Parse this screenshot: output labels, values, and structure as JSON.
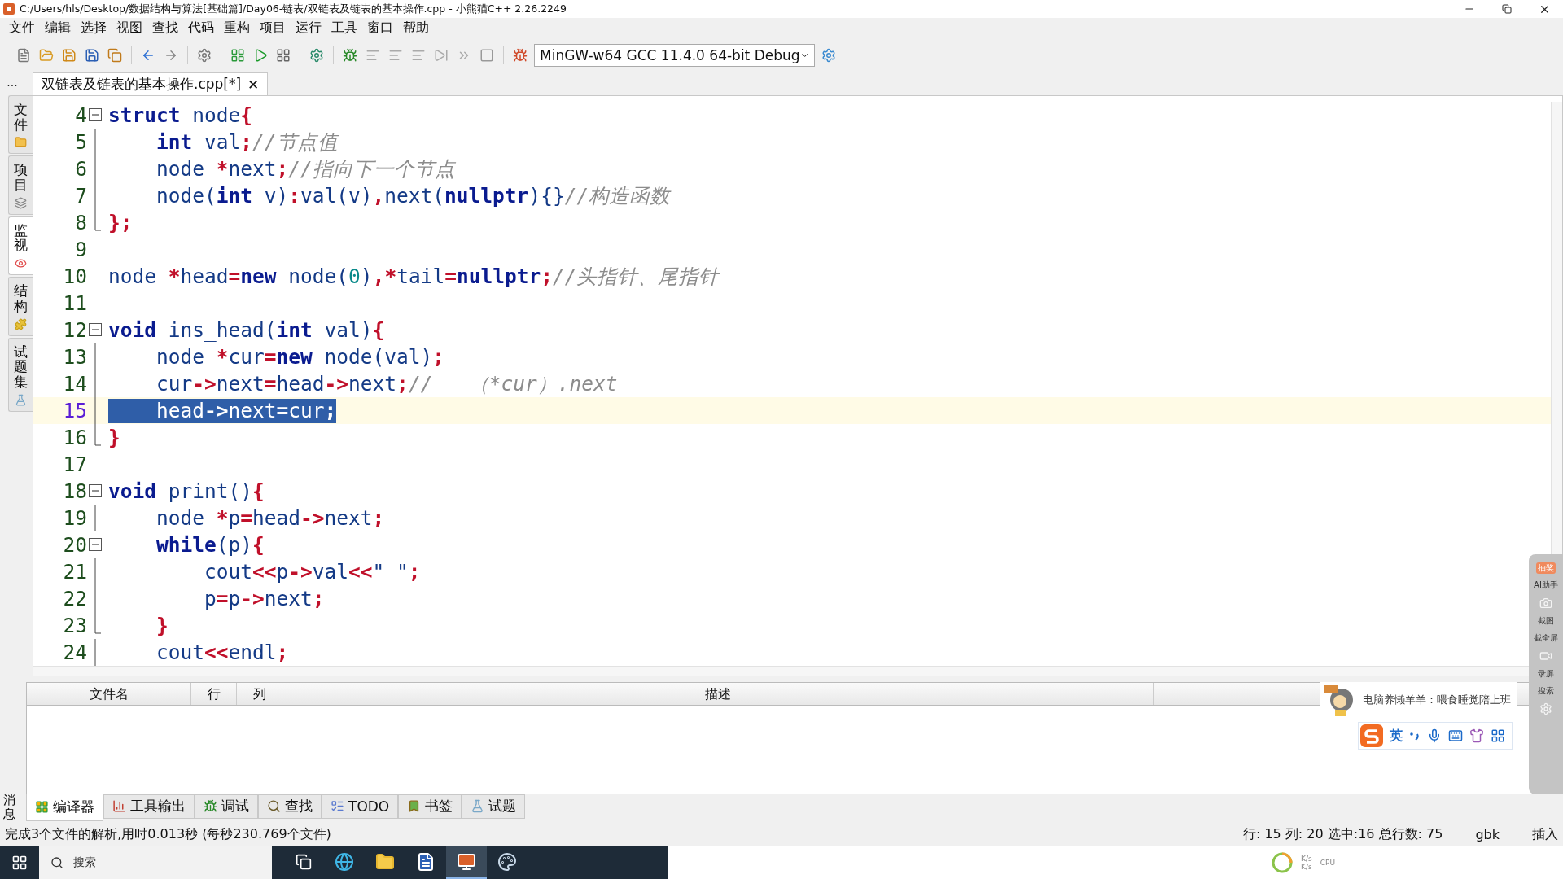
{
  "window": {
    "title": "C:/Users/hls/Desktop/数据结构与算法[基础篇]/Day06-链表/双链表及链表的基本操作.cpp  - 小熊猫C++ 2.26.2249"
  },
  "menu": [
    "文件",
    "编辑",
    "选择",
    "视图",
    "查找",
    "代码",
    "重构",
    "项目",
    "运行",
    "工具",
    "窗口",
    "帮助"
  ],
  "toolbar": {
    "compiler": "MinGW-w64 GCC 11.4.0 64-bit Debug"
  },
  "side_tabs": [
    {
      "label": "文件",
      "kind": "folder",
      "selected": false
    },
    {
      "label": "项目",
      "kind": "stack",
      "selected": false
    },
    {
      "label": "监视",
      "kind": "watch",
      "selected": true
    },
    {
      "label": "结构",
      "kind": "puzzle",
      "selected": false
    },
    {
      "label": "试题集",
      "kind": "flask",
      "selected": false
    }
  ],
  "editor": {
    "more": "...",
    "tab": {
      "label": "双链表及链表的基本操作.cpp[*]",
      "close": "✕"
    },
    "lines": [
      {
        "number": "4",
        "fold_start": true,
        "fold_end": false,
        "current": false,
        "selected": false,
        "tokens": [
          {
            "kind": "keyword",
            "text": "struct"
          },
          {
            "kind": "ident",
            "text": " node"
          },
          {
            "kind": "op",
            "text": "{"
          }
        ]
      },
      {
        "number": "5",
        "fold_start": false,
        "fold_end": false,
        "current": false,
        "selected": false,
        "tokens": [
          {
            "kind": "keyword",
            "text": "    int"
          },
          {
            "kind": "ident",
            "text": " val"
          },
          {
            "kind": "op",
            "text": ";"
          },
          {
            "kind": "comment",
            "text": "//节点值"
          }
        ]
      },
      {
        "number": "6",
        "fold_start": false,
        "fold_end": false,
        "current": false,
        "selected": false,
        "tokens": [
          {
            "kind": "ident",
            "text": "    node "
          },
          {
            "kind": "op",
            "text": "*"
          },
          {
            "kind": "ident",
            "text": "next"
          },
          {
            "kind": "op",
            "text": ";"
          },
          {
            "kind": "comment",
            "text": "//指向下一个节点"
          }
        ]
      },
      {
        "number": "7",
        "fold_start": false,
        "fold_end": false,
        "current": false,
        "selected": false,
        "tokens": [
          {
            "kind": "ident",
            "text": "    node("
          },
          {
            "kind": "keyword",
            "text": "int"
          },
          {
            "kind": "ident",
            "text": " v)"
          },
          {
            "kind": "op",
            "text": ":"
          },
          {
            "kind": "ident",
            "text": "val(v)"
          },
          {
            "kind": "op",
            "text": ","
          },
          {
            "kind": "ident",
            "text": "next("
          },
          {
            "kind": "keyword",
            "text": "nullptr"
          },
          {
            "kind": "ident",
            "text": "){}"
          },
          {
            "kind": "comment",
            "text": "//构造函数"
          }
        ]
      },
      {
        "number": "8",
        "fold_start": false,
        "fold_end": true,
        "current": false,
        "selected": false,
        "tokens": [
          {
            "kind": "op",
            "text": "};"
          }
        ]
      },
      {
        "number": "9",
        "fold_start": false,
        "fold_end": false,
        "current": false
      },
      {
        "number": "10",
        "fold_start": false,
        "fold_end": false,
        "current": false,
        "selected": false,
        "tokens": [
          {
            "kind": "ident",
            "text": "node "
          },
          {
            "kind": "op",
            "text": "*"
          },
          {
            "kind": "ident",
            "text": "head"
          },
          {
            "kind": "op",
            "text": "="
          },
          {
            "kind": "keyword",
            "text": "new"
          },
          {
            "kind": "ident",
            "text": " node("
          },
          {
            "kind": "number",
            "text": "0"
          },
          {
            "kind": "ident",
            "text": ")"
          },
          {
            "kind": "op",
            "text": ",*"
          },
          {
            "kind": "ident",
            "text": "tail"
          },
          {
            "kind": "op",
            "text": "="
          },
          {
            "kind": "keyword",
            "text": "nullptr"
          },
          {
            "kind": "op",
            "text": ";"
          },
          {
            "kind": "comment",
            "text": "//头指针、尾指针"
          }
        ]
      },
      {
        "number": "11",
        "fold_start": false,
        "fold_end": false,
        "current": false
      },
      {
        "number": "12",
        "fold_start": true,
        "fold_end": false,
        "current": false,
        "selected": false,
        "tokens": [
          {
            "kind": "keyword",
            "text": "void"
          },
          {
            "kind": "ident",
            "text": " ins_head("
          },
          {
            "kind": "keyword",
            "text": "int"
          },
          {
            "kind": "ident",
            "text": " val)"
          },
          {
            "kind": "op",
            "text": "{"
          }
        ]
      },
      {
        "number": "13",
        "fold_start": false,
        "fold_end": false,
        "current": false,
        "selected": false,
        "tokens": [
          {
            "kind": "ident",
            "text": "    node "
          },
          {
            "kind": "op",
            "text": "*"
          },
          {
            "kind": "ident",
            "text": "cur"
          },
          {
            "kind": "op",
            "text": "="
          },
          {
            "kind": "keyword",
            "text": "new"
          },
          {
            "kind": "ident",
            "text": " node(val)"
          },
          {
            "kind": "op",
            "text": ";"
          }
        ]
      },
      {
        "number": "14",
        "fold_start": false,
        "fold_end": false,
        "current": false,
        "selected": false,
        "tokens": [
          {
            "kind": "ident",
            "text": "    cur"
          },
          {
            "kind": "op",
            "text": "->"
          },
          {
            "kind": "ident",
            "text": "next"
          },
          {
            "kind": "op",
            "text": "="
          },
          {
            "kind": "ident",
            "text": "head"
          },
          {
            "kind": "op",
            "text": "->"
          },
          {
            "kind": "ident",
            "text": "next"
          },
          {
            "kind": "op",
            "text": ";"
          },
          {
            "kind": "comment",
            "text": "//   （*cur）.next"
          }
        ]
      },
      {
        "number": "15",
        "fold_start": false,
        "fold_end": false,
        "current": true,
        "selected": true,
        "tokens": [
          {
            "kind": "ident",
            "text": "    head"
          },
          {
            "kind": "op",
            "text": "->"
          },
          {
            "kind": "ident",
            "text": "next"
          },
          {
            "kind": "op",
            "text": "="
          },
          {
            "kind": "ident",
            "text": "cur"
          },
          {
            "kind": "op",
            "text": ";"
          }
        ]
      },
      {
        "number": "16",
        "fold_start": false,
        "fold_end": true,
        "current": false,
        "selected": false,
        "tokens": [
          {
            "kind": "op",
            "text": "}"
          }
        ]
      },
      {
        "number": "17",
        "fold_start": false,
        "fold_end": false,
        "current": false
      },
      {
        "number": "18",
        "fold_start": true,
        "fold_end": false,
        "current": false,
        "selected": false,
        "tokens": [
          {
            "kind": "keyword",
            "text": "void"
          },
          {
            "kind": "ident",
            "text": " print()"
          },
          {
            "kind": "op",
            "text": "{"
          }
        ]
      },
      {
        "number": "19",
        "fold_start": false,
        "fold_end": false,
        "current": false,
        "selected": false,
        "tokens": [
          {
            "kind": "ident",
            "text": "    node "
          },
          {
            "kind": "op",
            "text": "*"
          },
          {
            "kind": "ident",
            "text": "p"
          },
          {
            "kind": "op",
            "text": "="
          },
          {
            "kind": "ident",
            "text": "head"
          },
          {
            "kind": "op",
            "text": "->"
          },
          {
            "kind": "ident",
            "text": "next"
          },
          {
            "kind": "op",
            "text": ";"
          }
        ]
      },
      {
        "number": "20",
        "fold_start": true,
        "fold_end": false,
        "current": false,
        "selected": false,
        "tokens": [
          {
            "kind": "keyword",
            "text": "    while"
          },
          {
            "kind": "ident",
            "text": "(p)"
          },
          {
            "kind": "op",
            "text": "{"
          }
        ]
      },
      {
        "number": "21",
        "fold_start": false,
        "fold_end": false,
        "current": false,
        "selected": false,
        "tokens": [
          {
            "kind": "ident",
            "text": "        cout"
          },
          {
            "kind": "op",
            "text": "<<"
          },
          {
            "kind": "ident",
            "text": "p"
          },
          {
            "kind": "op",
            "text": "->"
          },
          {
            "kind": "ident",
            "text": "val"
          },
          {
            "kind": "op",
            "text": "<<"
          },
          {
            "kind": "string",
            "text": "\" \""
          },
          {
            "kind": "op",
            "text": ";"
          }
        ]
      },
      {
        "number": "22",
        "fold_start": false,
        "fold_end": false,
        "current": false,
        "selected": false,
        "tokens": [
          {
            "kind": "ident",
            "text": "        p"
          },
          {
            "kind": "op",
            "text": "="
          },
          {
            "kind": "ident",
            "text": "p"
          },
          {
            "kind": "op",
            "text": "->"
          },
          {
            "kind": "ident",
            "text": "next"
          },
          {
            "kind": "op",
            "text": ";"
          }
        ]
      },
      {
        "number": "23",
        "fold_start": false,
        "fold_end": true,
        "current": false,
        "selected": false,
        "tokens": [
          {
            "kind": "op",
            "text": "    }"
          }
        ]
      },
      {
        "number": "24",
        "fold_start": false,
        "fold_end": false,
        "current": false,
        "selected": false,
        "tokens": [
          {
            "kind": "ident",
            "text": "    cout"
          },
          {
            "kind": "op",
            "text": "<<"
          },
          {
            "kind": "ident",
            "text": "endl"
          },
          {
            "kind": "op",
            "text": ";"
          }
        ]
      }
    ]
  },
  "messages": {
    "side_label": "消息",
    "columns": [
      "文件名",
      "行",
      "列",
      "描述"
    ]
  },
  "bottom_tabs": [
    {
      "label": "编译器",
      "kind": "compiler",
      "selected": true
    },
    {
      "label": "工具输出",
      "kind": "chart",
      "selected": false
    },
    {
      "label": "调试",
      "kind": "bug",
      "selected": false
    },
    {
      "label": "查找",
      "kind": "search",
      "selected": false
    },
    {
      "label": "TODO",
      "kind": "todo",
      "selected": false
    },
    {
      "label": "书签",
      "kind": "bookmark",
      "selected": false
    },
    {
      "label": "试题",
      "kind": "flask",
      "selected": false
    }
  ],
  "status_bar": {
    "message": "完成3个文件的解析,用时0.013秒 (每秒230.769个文件)",
    "position": "行: 15 列: 20 选中:16 总行数: 75",
    "encoding": "gbk",
    "mode": "插入"
  },
  "overlays": {
    "mascot_text": "电脑养懒羊羊：喂食睡觉陪上班",
    "ime_mode": "英",
    "side_panel": [
      "抽奖",
      "AI助手",
      "截图",
      "截全屏",
      "录屏",
      "搜索"
    ]
  },
  "taskbar": {
    "search_placeholder": "搜索",
    "apps": [
      {
        "kind": "taskview",
        "selected": false
      },
      {
        "kind": "browser",
        "selected": false
      },
      {
        "kind": "folder",
        "selected": false
      },
      {
        "kind": "word",
        "selected": false
      },
      {
        "kind": "dev",
        "selected": true
      },
      {
        "kind": "paint",
        "selected": false
      }
    ],
    "meters": [
      "K/s",
      "K/s",
      "CPU"
    ]
  }
}
